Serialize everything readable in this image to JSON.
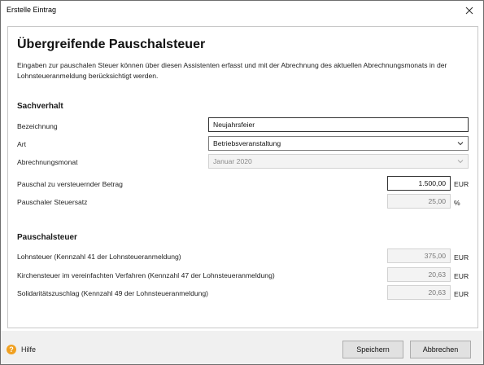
{
  "window": {
    "title": "Erstelle Eintrag"
  },
  "header": {
    "title": "Übergreifende Pauschalsteuer",
    "description": "Eingaben zur pauschalen Steuer können über diesen Assistenten erfasst und mit der Abrechnung des aktuellen Abrechnungsmonats in der Lohnsteueranmeldung berücksichtigt werden."
  },
  "sachverhalt": {
    "heading": "Sachverhalt",
    "bezeichnung": {
      "label": "Bezeichnung",
      "value": "Neujahrsfeier"
    },
    "art": {
      "label": "Art",
      "value": "Betriebsveranstaltung"
    },
    "abrechnungsmonat": {
      "label": "Abrechnungsmonat",
      "value": "Januar 2020"
    },
    "betrag": {
      "label": "Pauschal zu versteuernder Betrag",
      "value": "1.500,00",
      "unit": "EUR"
    },
    "steuersatz": {
      "label": "Pauschaler Steuersatz",
      "value": "25,00",
      "unit": "%"
    }
  },
  "pauschalsteuer": {
    "heading": "Pauschalsteuer",
    "lohnsteuer": {
      "label": "Lohnsteuer (Kennzahl 41 der Lohnsteueranmeldung)",
      "value": "375,00",
      "unit": "EUR"
    },
    "kirchensteuer": {
      "label": "Kirchensteuer im vereinfachten Verfahren (Kennzahl 47 der Lohnsteueranmeldung)",
      "value": "20,63",
      "unit": "EUR"
    },
    "soli": {
      "label": "Solidaritätszuschlag (Kennzahl 49 der Lohnsteueranmeldung)",
      "value": "20,63",
      "unit": "EUR"
    }
  },
  "footer": {
    "help": "Hilfe",
    "save": "Speichern",
    "cancel": "Abbrechen"
  },
  "colors": {
    "help_icon": "#f0a020",
    "footer_bg": "#f0f0f0",
    "readonly_bg": "#f3f3f3"
  }
}
